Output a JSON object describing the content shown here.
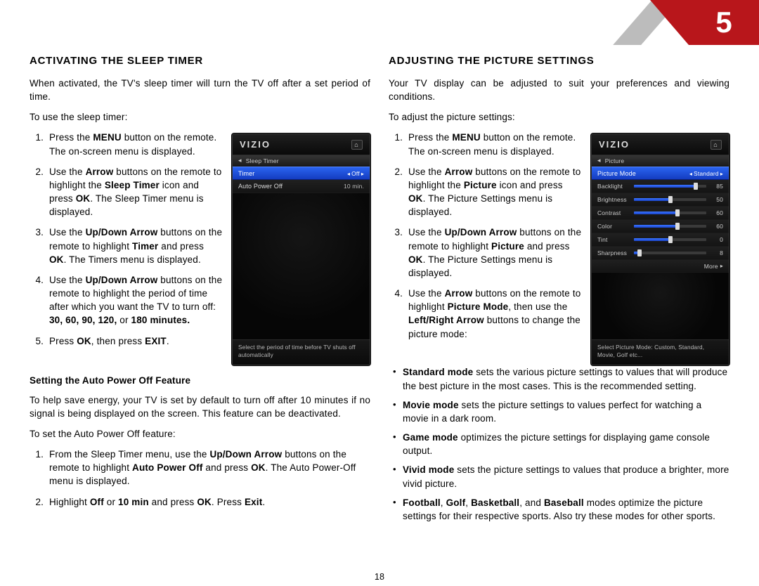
{
  "chapter_number": "5",
  "page_number": "18",
  "left": {
    "heading": "ACTIVATING THE SLEEP TIMER",
    "intro": "When activated, the TV's sleep timer will turn the TV off after a set period of time.",
    "lead": "To use the sleep timer:",
    "subhead": "Setting the Auto Power Off Feature",
    "sub_intro": "To help save energy, your TV is set by default to turn off after 10 minutes if no signal is being displayed on the screen. This feature can be deactivated.",
    "sub_lead": "To set the Auto Power Off feature:"
  },
  "right": {
    "heading": "ADJUSTING THE PICTURE SETTINGS",
    "intro": "Your TV display can be adjusted to suit your preferences and viewing conditions.",
    "lead": "To adjust the picture settings:"
  },
  "osd_sleep": {
    "logo": "VIZIO",
    "crumb": "Sleep Timer",
    "row1_label": "Timer",
    "row1_value": "Off",
    "row2_label": "Auto Power Off",
    "row2_value": "10 min.",
    "footer": "Select the period of time before TV shuts off automatically"
  },
  "osd_picture": {
    "logo": "VIZIO",
    "crumb": "Picture",
    "mode_label": "Picture Mode",
    "mode_value": "Standard",
    "sliders": [
      {
        "label": "Backlight",
        "value": 85,
        "max": 100
      },
      {
        "label": "Brightness",
        "value": 50,
        "max": 100
      },
      {
        "label": "Contrast",
        "value": 60,
        "max": 100
      },
      {
        "label": "Color",
        "value": 60,
        "max": 100
      },
      {
        "label": "Tint",
        "value": 0,
        "max": 100,
        "center": true
      },
      {
        "label": "Sharpness",
        "value": 8,
        "max": 100
      }
    ],
    "more": "More",
    "footer": "Select Picture Mode: Custom, Standard, Movie, Golf etc..."
  }
}
